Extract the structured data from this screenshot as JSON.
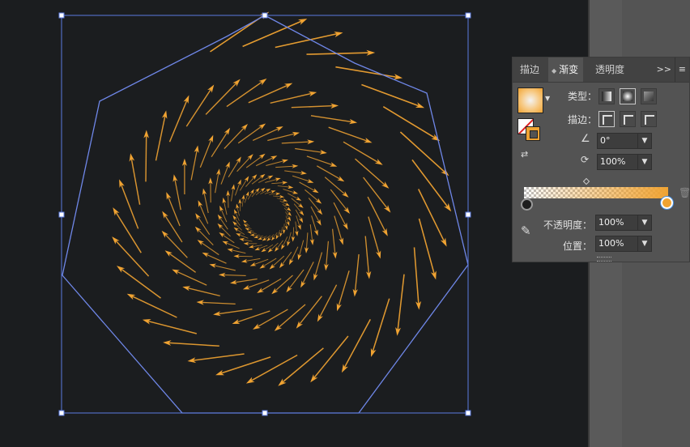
{
  "panel": {
    "tabs": [
      {
        "label": "描边"
      },
      {
        "label": "渐变"
      },
      {
        "label": "透明度"
      }
    ],
    "type_label": "类型：",
    "stroke_label": "描边：",
    "angle_value": "0°",
    "aspect_value": "100%",
    "opacity_label": "不透明度：",
    "opacity_value": "100%",
    "location_label": "位置：",
    "location_value": "100%"
  },
  "gradient": {
    "start_color": "#1d1d1d",
    "end_color": "#f0a332",
    "start_stop_position": 0,
    "end_stop_position": 1
  },
  "icons": {
    "eyedropper": "eyedropper-icon",
    "trash": "trash-icon",
    "angle": "angle-icon",
    "aspect": "aspect-ratio-icon"
  },
  "colors": {
    "accent": "#f0a332",
    "selection": "#5b7be0",
    "canvas": "#1b1d1f",
    "panel": "#535353"
  }
}
